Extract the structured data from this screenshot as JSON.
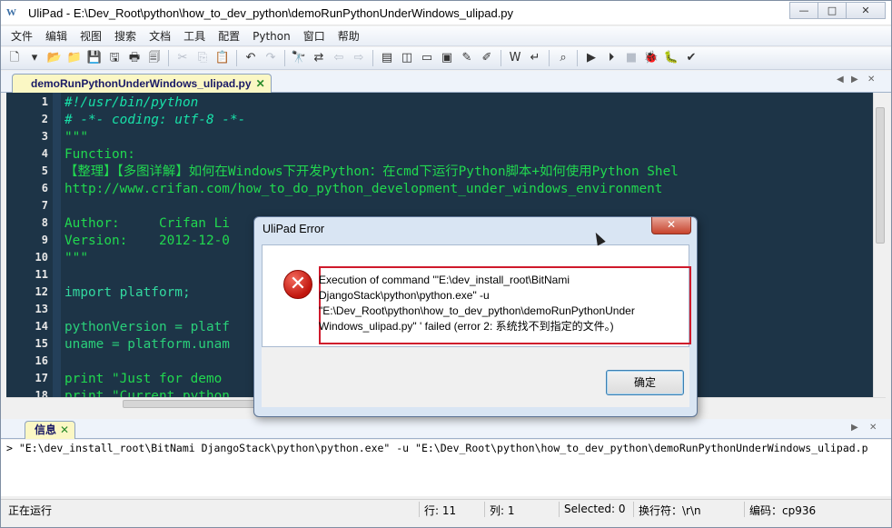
{
  "window": {
    "app_icon": "W",
    "title": "UliPad - E:\\Dev_Root\\python\\how_to_dev_python\\demoRunPythonUnderWindows_ulipad.py",
    "min_glyph": "—",
    "max_glyph": "□",
    "close_glyph": "✕"
  },
  "menu": [
    "文件",
    "编辑",
    "视图",
    "搜索",
    "文档",
    "工具",
    "配置",
    "Python",
    "窗口",
    "帮助"
  ],
  "toolbar_icons": [
    {
      "name": "new-file-icon",
      "glyph": "🗋"
    },
    {
      "name": "new-dropdown-icon",
      "glyph": "▾"
    },
    {
      "name": "open-folder-icon",
      "glyph": "📂"
    },
    {
      "name": "open-icon",
      "glyph": "📁"
    },
    {
      "name": "save-icon",
      "glyph": "💾"
    },
    {
      "name": "save-all-icon",
      "glyph": "🖫"
    },
    {
      "name": "print-icon",
      "glyph": "🖶"
    },
    {
      "name": "print-preview-icon",
      "glyph": "🗐"
    },
    {
      "name": "cut-icon",
      "glyph": "✂"
    },
    {
      "name": "copy-icon",
      "glyph": "⎘"
    },
    {
      "name": "paste-icon",
      "glyph": "📋"
    },
    {
      "name": "undo-icon",
      "glyph": "↶"
    },
    {
      "name": "redo-icon",
      "glyph": "↷"
    },
    {
      "name": "find-icon",
      "glyph": "🔭"
    },
    {
      "name": "replace-icon",
      "glyph": "⇄"
    },
    {
      "name": "back-icon",
      "glyph": "⇦"
    },
    {
      "name": "forward-icon",
      "glyph": "⇨"
    },
    {
      "name": "properties-icon",
      "glyph": "▤"
    },
    {
      "name": "layout-icon",
      "glyph": "◫"
    },
    {
      "name": "panel-icon",
      "glyph": "▭"
    },
    {
      "name": "python-shell-icon",
      "glyph": "▣"
    },
    {
      "name": "snippet-icon",
      "glyph": "✎"
    },
    {
      "name": "pencil-icon",
      "glyph": "✐"
    },
    {
      "name": "wrap-icon",
      "glyph": "W"
    },
    {
      "name": "goto-icon",
      "glyph": "↵"
    },
    {
      "name": "search-doc-icon",
      "glyph": "⌕"
    },
    {
      "name": "run-icon",
      "glyph": "▶"
    },
    {
      "name": "run-args-icon",
      "glyph": "⏵"
    },
    {
      "name": "stop-icon",
      "glyph": "■"
    },
    {
      "name": "debug-icon",
      "glyph": "🐞"
    },
    {
      "name": "debug2-icon",
      "glyph": "🐛"
    },
    {
      "name": "check-icon",
      "glyph": "✔"
    }
  ],
  "editor_tab": {
    "label": "demoRunPythonUnderWindows_ulipad.py",
    "close": "✕"
  },
  "tab_nav": {
    "left": "◀",
    "right": "▶",
    "close": "✕"
  },
  "code": {
    "line_numbers": [
      "1",
      "2",
      "3",
      "4",
      "5",
      "6",
      "7",
      "8",
      "9",
      "10",
      "11",
      "12",
      "13",
      "14",
      "15",
      "16",
      "17",
      "18"
    ],
    "lines": [
      {
        "cls": "c-comment",
        "text": "#!/usr/bin/python"
      },
      {
        "cls": "c-comment",
        "text": "# -*- coding: utf-8 -*-"
      },
      {
        "cls": "c-string",
        "text": "\"\"\""
      },
      {
        "cls": "c-string",
        "text": "Function:"
      },
      {
        "cls": "c-string",
        "text": "【整理】【多图详解】如何在Windows下开发Python：在cmd下运行Python脚本+如何使用Python Shel"
      },
      {
        "cls": "c-url",
        "text": "http://www.crifan.com/how_to_do_python_development_under_windows_environment"
      },
      {
        "cls": "c-string",
        "text": ""
      },
      {
        "cls": "c-string",
        "text": "Author:     Crifan Li"
      },
      {
        "cls": "c-string",
        "text": "Version:    2012-12-0"
      },
      {
        "cls": "c-string",
        "text": "\"\"\""
      },
      {
        "cls": "c-id",
        "text": ""
      },
      {
        "cls": "c-kw",
        "text": "import platform;"
      },
      {
        "cls": "c-id",
        "text": ""
      },
      {
        "cls": "c-id",
        "text": "pythonVersion = platf"
      },
      {
        "cls": "c-id",
        "text": "uname = platform.unam"
      },
      {
        "cls": "c-id",
        "text": ""
      },
      {
        "cls": "c-string",
        "text": "print \"Just for demo "
      },
      {
        "cls": "c-string",
        "text": "print \"Current python"
      }
    ]
  },
  "info_panel": {
    "tab_label": "信息",
    "tab_close": "✕",
    "output": "> \"E:\\dev_install_root\\BitNami DjangoStack\\python\\python.exe\" -u \"E:\\Dev_Root\\python\\how_to_dev_python\\demoRunPythonUnderWindows_ulipad.p"
  },
  "statusbar": {
    "state": "正在运行",
    "row": "行: 11",
    "col": "列: 1",
    "selected": "Selected: 0",
    "eol": "换行符：\\r\\n",
    "encoding": "编码：cp936"
  },
  "dialog": {
    "title": "UliPad Error",
    "close_glyph": "✕",
    "icon_glyph": "✕",
    "message_lines": [
      "Execution of command '\"E:\\dev_install_root\\BitNami",
      "DjangoStack\\python\\python.exe\" -u",
      "\"E:\\Dev_Root\\python\\how_to_dev_python\\demoRunPythonUnder",
      "Windows_ulipad.py\" ' failed (error 2: 系统找不到指定的文件。)"
    ],
    "ok_label": "确定"
  }
}
